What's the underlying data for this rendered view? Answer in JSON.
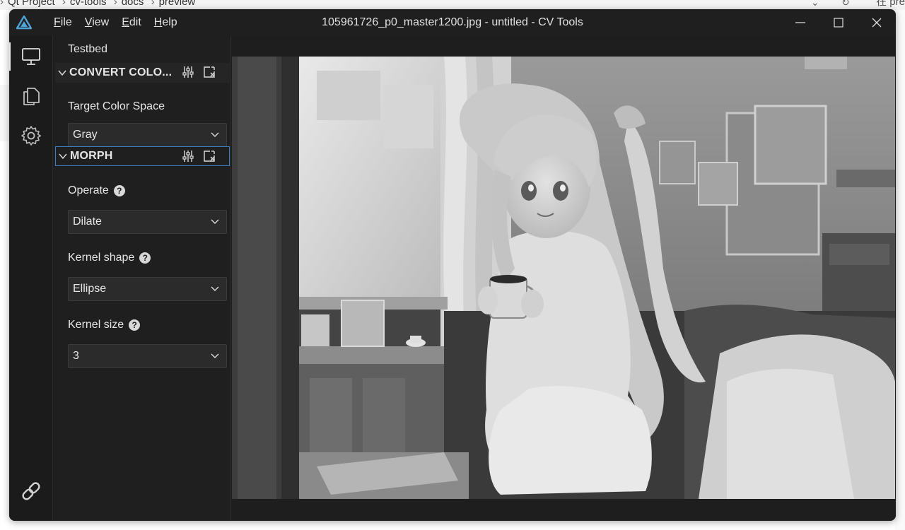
{
  "background": {
    "breadcrumbs": [
      "Qt Project",
      "cv-tools",
      "docs",
      "preview"
    ],
    "right_text": "在 pre"
  },
  "window": {
    "title": "105961726_p0_master1200.jpg - untitled - CV Tools",
    "menu": [
      {
        "accel": "F",
        "rest": "ile"
      },
      {
        "accel": "V",
        "rest": "iew"
      },
      {
        "accel": "E",
        "rest": "dit"
      },
      {
        "accel": "H",
        "rest": "elp"
      }
    ]
  },
  "activity_bar": {
    "items": [
      "monitor-icon",
      "copy-icon",
      "gear-icon"
    ],
    "bottom": "link-icon"
  },
  "panel": {
    "title": "Testbed",
    "sections": [
      {
        "title": "CONVERT COLO...",
        "fields": [
          {
            "label": "Target Color Space",
            "value": "Gray",
            "help": false
          }
        ]
      },
      {
        "title": "MORPH",
        "fields": [
          {
            "label": "Operate",
            "value": "Dilate",
            "help": true
          },
          {
            "label": "Kernel shape",
            "value": "Ellipse",
            "help": true
          },
          {
            "label": "Kernel size",
            "value": "3",
            "help": true
          }
        ]
      }
    ],
    "help_glyph": "?"
  },
  "colors": {
    "window_bg": "#1e1e1e",
    "focus_border": "#3c7fc0",
    "logo": "#4fa3d9"
  }
}
